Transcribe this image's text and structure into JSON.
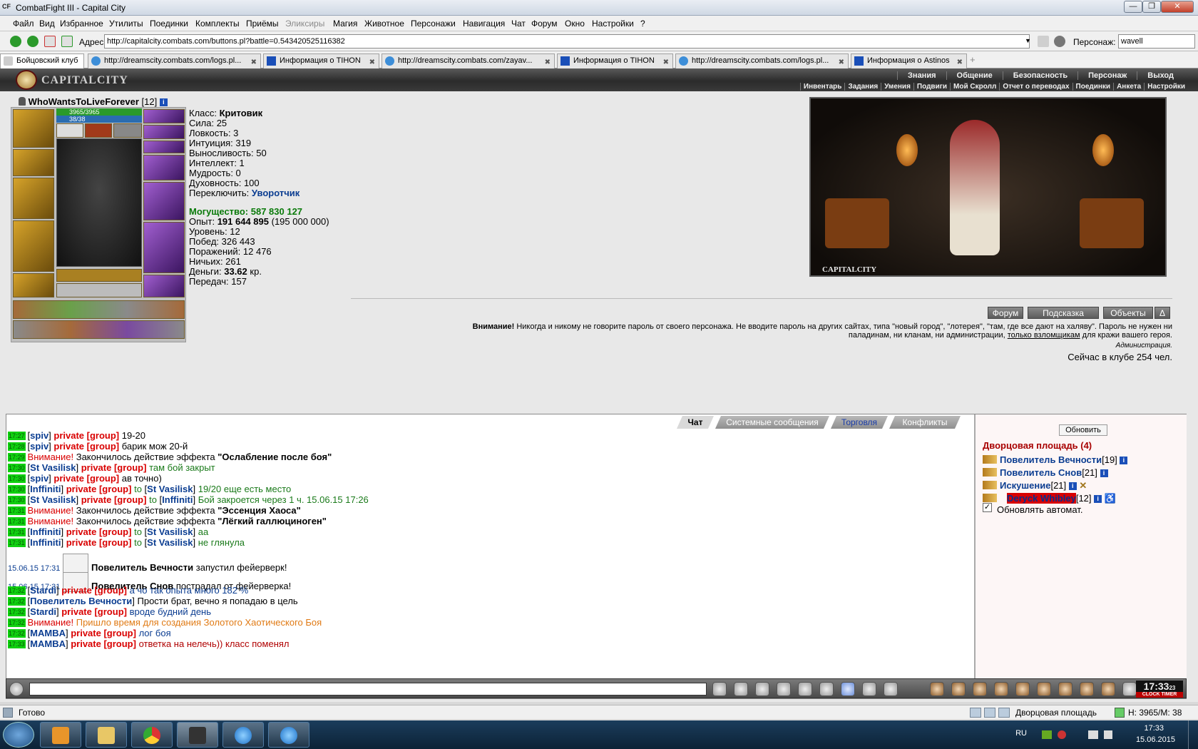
{
  "window": {
    "title": "CombatFight III - Capital City",
    "logo_text": "CF",
    "controls": {
      "minimize": "—",
      "maximize": "❐",
      "close": "✕"
    }
  },
  "menu": [
    "Файл",
    "Вид",
    "Избранное",
    "Утилиты",
    "Поединки",
    "Комплекты",
    "Приёмы",
    "Эликсиры",
    "Магия",
    "Животное",
    "Персонажи",
    "Навигация",
    "Чат",
    "Форум",
    "Окно",
    "Настройки",
    "?"
  ],
  "address": {
    "label": "Адрес:",
    "url": "http://capitalcity.combats.com/buttons.pl?battle=0.543420525116382",
    "persona_label": "Персонаж:",
    "persona_value": "wavell"
  },
  "tabs": [
    {
      "label": "Бойцовский клуб",
      "icon": "cf-icon"
    },
    {
      "label": "http://dreamscity.combats.com/logs.pl...",
      "icon": "globe-icon"
    },
    {
      "label": "Информация о TIHON",
      "icon": "info-icon"
    },
    {
      "label": "http://dreamscity.combats.com/zayav...",
      "icon": "globe-icon"
    },
    {
      "label": "Информация о TIHON",
      "icon": "info-icon"
    },
    {
      "label": "http://dreamscity.combats.com/logs.pl...",
      "icon": "globe-icon"
    },
    {
      "label": "Информация о Astinos",
      "icon": "info-icon"
    }
  ],
  "city": {
    "name": "CAPITALCITY",
    "top_links": [
      "Знания",
      "Общение",
      "Безопасность",
      "Персонаж",
      "Выход"
    ],
    "sub_links": [
      "Инвентарь",
      "Задания",
      "Умения",
      "Подвиги",
      "Мой Скролл",
      "Отчет о переводах",
      "Поединки",
      "Анкета",
      "Настройки"
    ]
  },
  "character": {
    "name": "WhoWantsToLiveForever",
    "level": "[12]",
    "hp": "3965/3965",
    "mp": "38/38",
    "hp_fraction": 1.0,
    "mp_fraction": 1.0,
    "stats": {
      "class_label": "Класс:",
      "class_value": "Критовик",
      "str": "Сила: 25",
      "agi": "Ловкость: 3",
      "int": "Интуиция: 319",
      "end": "Выносливость: 50",
      "intel": "Интеллект: 1",
      "wis": "Мудрость: 0",
      "spir": "Духовность: 100",
      "switch_label": "Переключить:",
      "switch_value": "Уворотчик",
      "power": "Могущество: 587 830 127",
      "exp_label": "Опыт:",
      "exp_value": "191 644 895",
      "exp_next": "(195 000 000)",
      "level": "Уровень: 12",
      "wins": "Побед: 326 443",
      "losses": "Поражений: 12 476",
      "draws": "Ничьих: 261",
      "money_label": "Деньги:",
      "money_value": "33.62",
      "money_unit": "кр.",
      "transfers": "Передач: 157"
    }
  },
  "scene": {
    "caption": "CAPITALCITY"
  },
  "panel_buttons": [
    "Форум",
    "Подсказка",
    "Объекты",
    "Δ"
  ],
  "warning": {
    "bold": "Внимание!",
    "text1": "Никогда и никому не говорите пароль от своего персонажа. Не вводите пароль на других сайтах, типа \"новый город\", \"лотерея\", \"там, где все дают на халяву\". Пароль не нужен ни",
    "text2": "паладинам, ни кланам, ни администрации,",
    "link": "только взломщикам",
    "text3": "для кражи вашего героя.",
    "admin": "Администрация.",
    "online": "Сейчас в клубе 254 чел."
  },
  "chat_tabs": [
    "Чат",
    "Системные сообщения",
    "Торговля",
    "Конфликты"
  ],
  "chat": [
    {
      "t": "17:27",
      "nick": "spiv",
      "priv": "private [group]",
      "msg": "19-20",
      "cls": ""
    },
    {
      "t": "17:28",
      "nick": "spiv",
      "priv": "private [group]",
      "msg": "барик мож 20-й",
      "cls": ""
    },
    {
      "t": "17:29",
      "att": "Внимание!",
      "msg": "Закончилось действие эффекта",
      "eff": "\"Ослабление после боя\""
    },
    {
      "t": "17:30",
      "nick": "St Vasilisk",
      "priv": "private [group]",
      "msg": "там бой закрыт",
      "cls": "gtxt"
    },
    {
      "t": "17:30",
      "nick": "spiv",
      "priv": "private [group]",
      "msg": "ав точно)",
      "cls": ""
    },
    {
      "t": "17:30",
      "nick": "Inffiniti",
      "priv": "private [group]",
      "to": "St Vasilisk",
      "msg": "19/20 еще есть место",
      "cls": "gtxt"
    },
    {
      "t": "17:30",
      "nick": "St Vasilisk",
      "priv": "private [group]",
      "to": "Inffiniti",
      "msg": "Бой закроется через 1 ч. 15.06.15 17:26",
      "cls": "gtxt"
    },
    {
      "t": "17:31",
      "att": "Внимание!",
      "msg": "Закончилось действие эффекта",
      "eff": "\"Эссенция Хаоса\""
    },
    {
      "t": "17:31",
      "att": "Внимание!",
      "msg": "Закончилось действие эффекта",
      "eff": "\"Лёгкий галлюциноген\""
    },
    {
      "t": "17:31",
      "nick": "Inffiniti",
      "priv": "private [group]",
      "to": "St Vasilisk",
      "msg": "аа",
      "cls": "gtxt"
    },
    {
      "t": "17:31",
      "nick": "Inffiniti",
      "priv": "private [group]",
      "to": "St Vasilisk",
      "msg": "не глянула",
      "cls": "gtxt"
    },
    {
      "fwdate": "15.06.15 17:31",
      "who": "Повелитель Вечности",
      "msg": "запустил фейерверк!"
    },
    {
      "fwdate": "15.06.15 17:31",
      "who": "Повелитель Снов",
      "msg": "пострадал от фейерверка!"
    },
    {
      "t": "17:32",
      "nick": "Stardi",
      "priv": "private [group]",
      "msg": "а чо так опыта много 182 %",
      "cls": "btxt"
    },
    {
      "t": "17:32",
      "nick": "Повелитель Вечности",
      "msg": "Прости брат, вечно я попадаю в цель",
      "cls": ""
    },
    {
      "t": "17:32",
      "nick": "Stardi",
      "priv": "private [group]",
      "msg": "вроде будний день",
      "cls": "btxt"
    },
    {
      "t": "17:32",
      "att": "Внимание!",
      "msg": "Пришло время для создания Золотого Хаотического Боя",
      "cls": "otxt"
    },
    {
      "t": "17:32",
      "nick": "MAMBA",
      "priv": "private [group]",
      "msg": "лог боя",
      "cls": "btxt"
    },
    {
      "t": "17:33",
      "nick": "MAMBA",
      "priv": "private [group]",
      "msg": "ответка на нелечь)) класс поменял",
      "cls": "rtxt"
    }
  ],
  "who": {
    "refresh": "Обновить",
    "location": "Дворцовая площадь (4)",
    "players": [
      {
        "name": "Повелитель Вечности",
        "lvl": "[19]"
      },
      {
        "name": "Повелитель Снов",
        "lvl": "[21]"
      },
      {
        "name": "Искушение",
        "lvl": "[21]"
      },
      {
        "name": "Deryck Whibley",
        "lvl": "[12]"
      }
    ],
    "auto_label": "Обновлять автомат.",
    "auto_checked": "✓"
  },
  "clock": {
    "time": "17:33",
    "sec": "23",
    "label": "CLOCK TIMER"
  },
  "status": {
    "ready": "Готово",
    "location": "Дворцовая площадь",
    "hm": "H: 3965/M: 38"
  },
  "tray": {
    "lang": "RU",
    "time": "17:33",
    "date": "15.06.2015"
  }
}
